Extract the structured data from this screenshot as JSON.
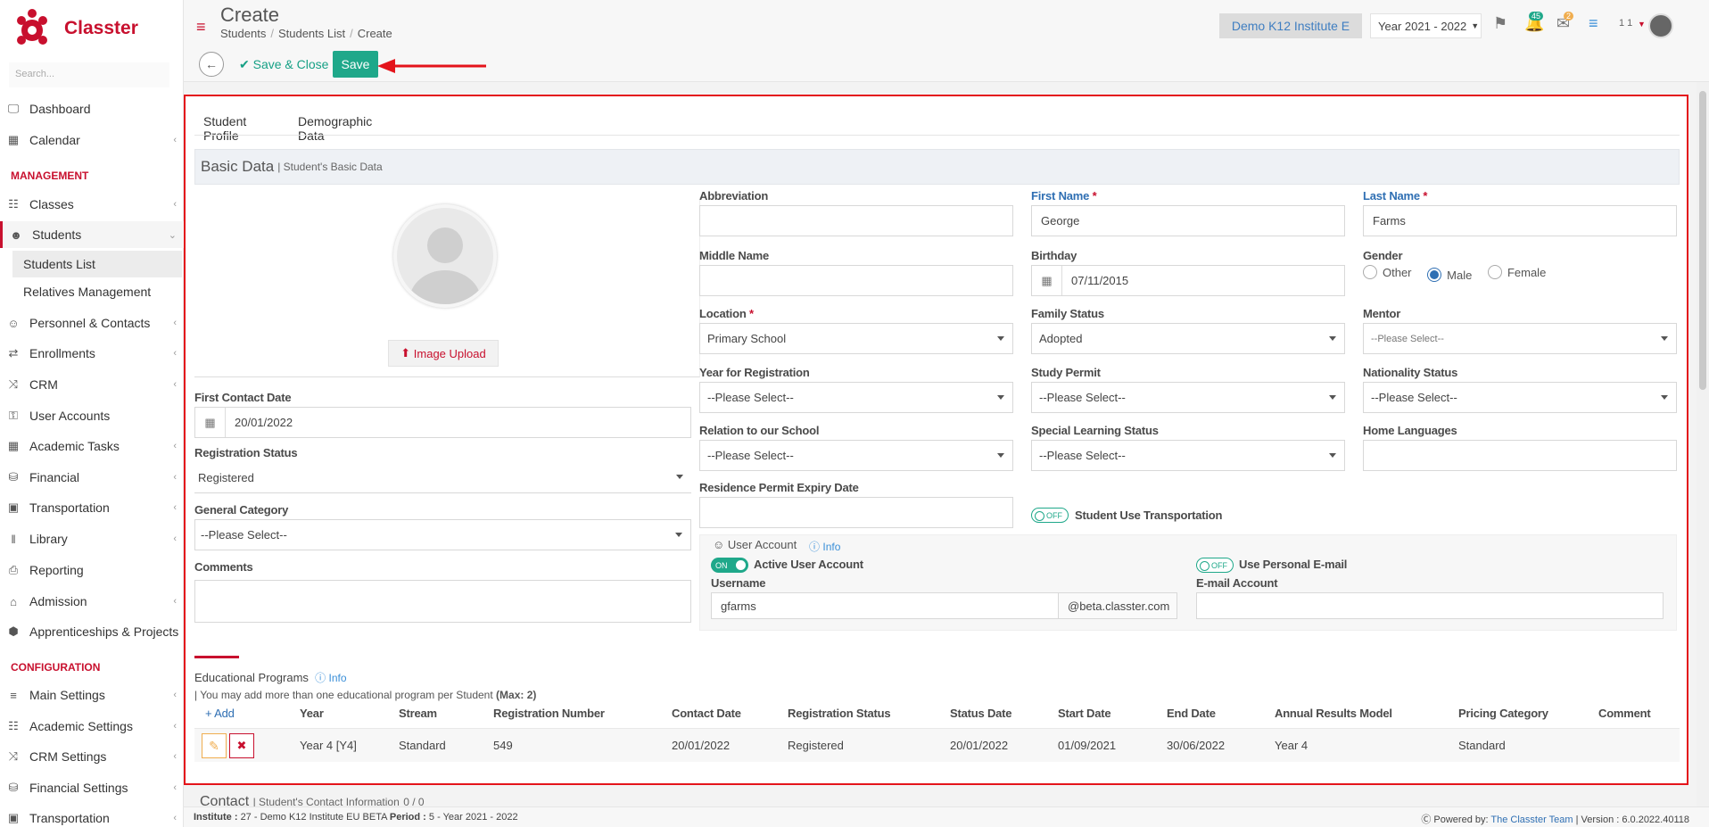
{
  "app": {
    "brand": "Classter",
    "brand_color": "#c8102e",
    "accent_color": "#1fa88a"
  },
  "sidebar": {
    "search_placeholder": "Search...",
    "items": [
      {
        "label": "Dashboard",
        "icon": "laptop-icon"
      },
      {
        "label": "Calendar",
        "icon": "calendar-icon"
      },
      {
        "label": "Classes",
        "icon": "classes-icon"
      },
      {
        "label": "Students",
        "icon": "students-icon"
      },
      {
        "label": "Personnel & Contacts",
        "icon": "person-icon"
      },
      {
        "label": "Enrollments",
        "icon": "exchange-icon"
      },
      {
        "label": "CRM",
        "icon": "crm-icon"
      },
      {
        "label": "User Accounts",
        "icon": "key-icon"
      },
      {
        "label": "Academic Tasks",
        "icon": "grid-icon"
      },
      {
        "label": "Financial",
        "icon": "coins-icon"
      },
      {
        "label": "Transportation",
        "icon": "bus-icon"
      },
      {
        "label": "Library",
        "icon": "library-icon"
      },
      {
        "label": "Reporting",
        "icon": "print-icon"
      },
      {
        "label": "Admission",
        "icon": "bank-icon"
      },
      {
        "label": "Apprenticeships & Projects",
        "icon": "cube-icon"
      },
      {
        "label": "Main Settings",
        "icon": "sliders-icon"
      },
      {
        "label": "Academic Settings",
        "icon": "classes-icon"
      },
      {
        "label": "CRM Settings",
        "icon": "crm-icon"
      },
      {
        "label": "Financial Settings",
        "icon": "coins-icon"
      },
      {
        "label": "Transportation",
        "icon": "bus-icon"
      }
    ],
    "sections": {
      "management": "MANAGEMENT",
      "configuration": "CONFIGURATION"
    },
    "students_sub": [
      "Students List",
      "Relatives Management"
    ]
  },
  "header": {
    "title": "Create",
    "breadcrumb": [
      "Students",
      "Students List",
      "Create"
    ],
    "institute": "Demo K12 Institute E",
    "year": "Year 2021 - 2022",
    "notif_count": "45",
    "mail_count": "2",
    "user_short": "1 1"
  },
  "toolbar": {
    "save_close": "Save & Close",
    "save": "Save"
  },
  "tabs": [
    "Student Profile",
    "Demographic Data"
  ],
  "basic": {
    "title": "Basic Data",
    "subtitle": "| Student's Basic Data"
  },
  "form": {
    "image_upload": "Image Upload",
    "first_contact_date_label": "First Contact Date",
    "first_contact_date": "20/01/2022",
    "registration_status_label": "Registration Status",
    "registration_status": "Registered",
    "general_category_label": "General Category",
    "general_category": "--Please Select--",
    "comments_label": "Comments",
    "abbreviation_label": "Abbreviation",
    "first_name_label": "First Name",
    "first_name": "George",
    "last_name_label": "Last Name",
    "last_name": "Farms",
    "middle_name_label": "Middle Name",
    "birthday_label": "Birthday",
    "birthday": "07/11/2015",
    "gender_label": "Gender",
    "gender_options": [
      "Other",
      "Male",
      "Female"
    ],
    "location_label": "Location",
    "location": "Primary School",
    "family_status_label": "Family Status",
    "family_status": "Adopted",
    "mentor_label": "Mentor",
    "mentor": "--Please Select--",
    "year_reg_label": "Year for Registration",
    "year_reg": "--Please Select--",
    "study_permit_label": "Study Permit",
    "study_permit": "--Please Select--",
    "nationality_label": "Nationality Status",
    "nationality": "--Please Select--",
    "relation_label": "Relation to our School",
    "relation": "--Please Select--",
    "special_label": "Special Learning Status",
    "special": "--Please Select--",
    "home_lang_label": "Home Languages",
    "residence_label": "Residence Permit Expiry Date",
    "transport_label": "Student Use Transportation",
    "toggle_off": "OFF",
    "toggle_on": "ON",
    "user_account_title": "User Account",
    "info": "Info",
    "active_user_label": "Active User Account",
    "personal_email_label": "Use Personal E-mail",
    "username_label": "Username",
    "username": "gfarms",
    "domain": "@beta.classter.com",
    "email_account_label": "E-mail Account"
  },
  "programs": {
    "title": "Educational Programs",
    "note": "| You may add more than one educational program per Student",
    "max": "(Max: 2)",
    "add": "Add",
    "headers": [
      "Year",
      "Stream",
      "Registration Number",
      "Contact Date",
      "Registration Status",
      "Status Date",
      "Start Date",
      "End Date",
      "Annual Results Model",
      "Pricing Category",
      "Comment"
    ],
    "row": [
      "Year 4 [Y4]",
      "Standard",
      "549",
      "20/01/2022",
      "Registered",
      "20/01/2022",
      "01/09/2021",
      "30/06/2022",
      "Year 4",
      "Standard",
      ""
    ]
  },
  "contact": {
    "title": "Contact",
    "subtitle": "| Student's Contact Information",
    "count": "0 / 0"
  },
  "footer": {
    "institute_label": "Institute :",
    "institute_value": "27 - Demo K12 Institute EU BETA",
    "period_label": "Period :",
    "period_value": "5 - Year 2021 - 2022",
    "powered": "Powered by:",
    "team": "The Classter Team",
    "version": "| Version : 6.0.2022.40118"
  }
}
